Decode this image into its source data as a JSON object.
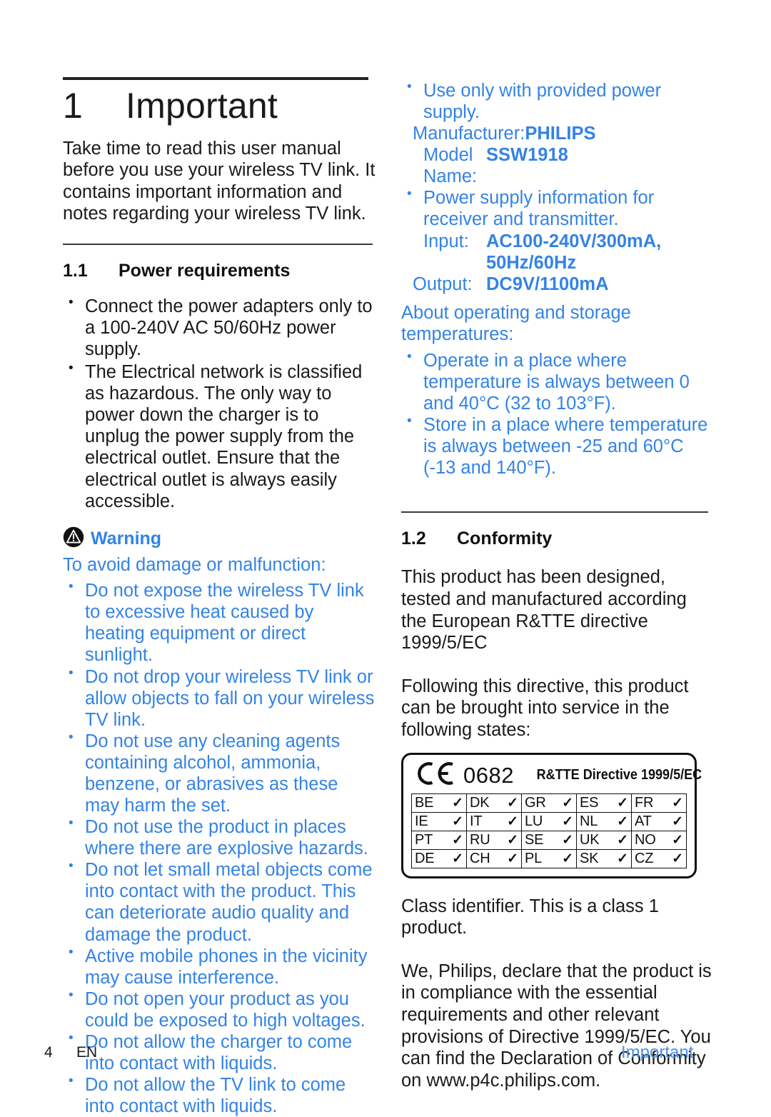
{
  "chapter": {
    "number": "1",
    "title": "Important",
    "intro": "Take time to read this user manual before you use your wireless TV link. It contains important information and notes regarding your wireless TV link."
  },
  "section_power": {
    "number": "1.1",
    "title": "Power requirements",
    "bullets": [
      "Connect the power adapters only to a 100-240V AC 50/60Hz power supply.",
      "The Electrical network is classified as hazardous. The only way to power down the charger is to unplug the power supply from the electrical outlet. Ensure that the electrical outlet is always easily accessible."
    ]
  },
  "warning": {
    "icon": "warning-triangle-icon",
    "label": "Warning",
    "lead": "To avoid damage or malfunction:",
    "bullets": [
      "Do not expose the wireless TV link to excessive heat caused by heating equipment or direct sunlight.",
      "Do not drop your wireless TV link or allow objects to fall on your wireless TV link.",
      "Do not use any cleaning agents containing alcohol, ammonia, benzene, or abrasives as these may harm the set.",
      "Do not use the product in places where there are explosive hazards.",
      "Do not let small metal objects come into contact with the product. This can deteriorate audio quality and damage the product.",
      "Active mobile phones in the vicinity may cause interference.",
      "Do not open your product as you could be exposed to high voltages.",
      "Do not allow the charger to come into contact with liquids.",
      "Do not allow the TV link to come into contact with liquids."
    ]
  },
  "power_supply": {
    "bullet_1": "Use only with provided power supply.",
    "manufacturer_label": "Manufacturer:",
    "manufacturer_value": "PHILIPS",
    "model_label": "Model Name:",
    "model_value": "SSW1918",
    "bullet_2": "Power supply information for receiver and transmitter.",
    "input_label": "Input:",
    "input_value_line1": "AC100-240V/300mA,",
    "input_value_line2": "50Hz/60Hz",
    "output_label": "Output:",
    "output_value": "DC9V/1100mA"
  },
  "temperatures": {
    "lead": "About operating and storage temperatures:",
    "bullets": [
      "Operate in a place where temperature is always between 0 and 40°C (32 to 103°F).",
      "Store in a place where temperature is always between -25 and 60°C (-13 and 140°F)."
    ]
  },
  "section_conformity": {
    "number": "1.2",
    "title": "Conformity",
    "para_1": "This product has been designed, tested and manufactured according the European R&TTE directive 1999/5/EC",
    "para_2": "Following this directive, this product can be brought into service in the following states:",
    "para_3": "Class identifier. This is a class 1 product.",
    "para_4": "We, Philips, declare that the product is in compliance with the essential requirements and other relevant provisions of Directive 1999/5/EC. You can find the Declaration of Conformity on www.p4c.philips.com."
  },
  "ce_box": {
    "logo": "ce-logo-icon",
    "notified_body_number": "0682",
    "directive_text": "R&TTE Directive 1999/5/EC",
    "tick": "✓",
    "rows": [
      [
        {
          "code": "BE"
        },
        {
          "code": "DK"
        },
        {
          "code": "GR"
        },
        {
          "code": "ES"
        },
        {
          "code": "FR"
        }
      ],
      [
        {
          "code": "IE"
        },
        {
          "code": "IT"
        },
        {
          "code": "LU"
        },
        {
          "code": "NL"
        },
        {
          "code": "AT"
        }
      ],
      [
        {
          "code": "PT"
        },
        {
          "code": "RU"
        },
        {
          "code": "SE"
        },
        {
          "code": "UK"
        },
        {
          "code": "NO"
        }
      ],
      [
        {
          "code": "DE"
        },
        {
          "code": "CH"
        },
        {
          "code": "PL"
        },
        {
          "code": "SK"
        },
        {
          "code": "CZ"
        }
      ]
    ]
  },
  "footer": {
    "page_number": "4",
    "language": "EN",
    "chapter_name": "Important"
  },
  "colors": {
    "blue": "#3383e6",
    "footer_blue": "#4a90e8",
    "text": "#1a1a1a",
    "rule": "#222222"
  }
}
